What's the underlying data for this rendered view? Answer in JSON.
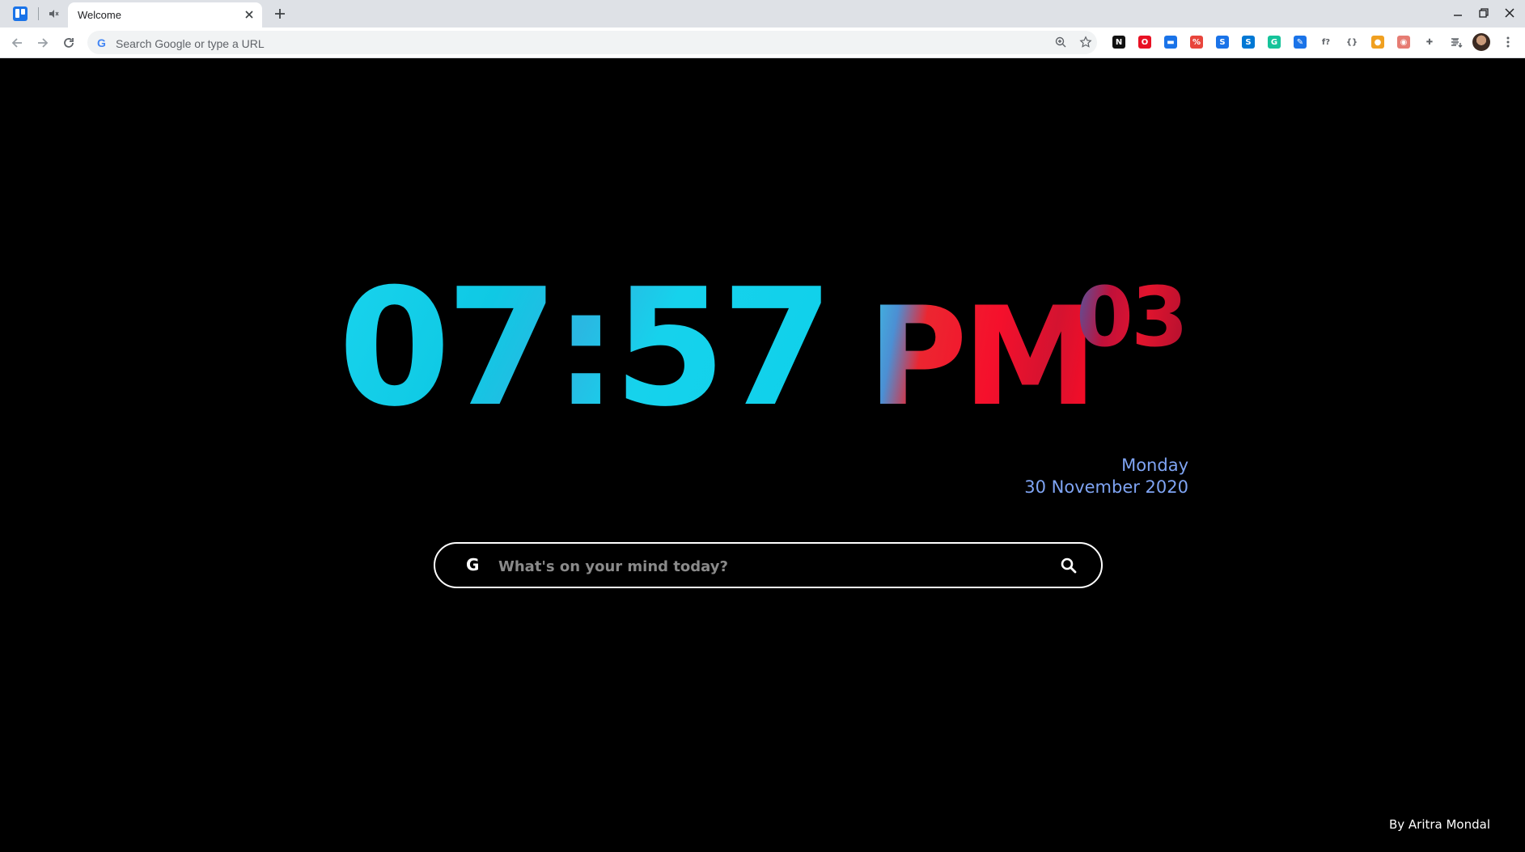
{
  "browser": {
    "tab_title": "Welcome",
    "omnibox_placeholder": "Search Google or type a URL",
    "omnibox_g": "G",
    "extensions": [
      {
        "name": "notion-extension-icon",
        "glyph": "N",
        "color": "#111111"
      },
      {
        "name": "opera-extension-icon",
        "glyph": "O",
        "color": "#e81123"
      },
      {
        "name": "meter-extension-icon",
        "glyph": "▬",
        "color": "#1a73e8"
      },
      {
        "name": "percent-extension-icon",
        "glyph": "%",
        "color": "#e8453c"
      },
      {
        "name": "swap-extension-icon",
        "glyph": "S",
        "color": "#1a73e8"
      },
      {
        "name": "skype-extension-icon",
        "glyph": "S",
        "color": "#0078d4"
      },
      {
        "name": "grammarly-extension-icon",
        "glyph": "G",
        "color": "#15c39a"
      },
      {
        "name": "pen-extension-icon",
        "glyph": "✎",
        "color": "#1a73e8"
      },
      {
        "name": "font-extension-icon",
        "glyph": "f?",
        "color": "#ffffff"
      },
      {
        "name": "code-extension-icon",
        "glyph": "{}",
        "color": "#ffffff"
      },
      {
        "name": "tampermonkey-extension-icon",
        "glyph": "●",
        "color": "#f0a020"
      },
      {
        "name": "shield-extension-icon",
        "glyph": "◉",
        "color": "#e67c73"
      },
      {
        "name": "puzzle-extensions-icon",
        "glyph": "✚",
        "color": "#ffffff"
      },
      {
        "name": "media-control-icon",
        "glyph": "≡",
        "color": "#ffffff"
      }
    ]
  },
  "clock": {
    "time": "07:57",
    "ampm": "PM",
    "seconds": "03"
  },
  "date": {
    "day": "Monday",
    "full": "30 November 2020"
  },
  "search": {
    "g": "G",
    "placeholder": "What's on your mind today?"
  },
  "credit": "By Aritra Mondal"
}
